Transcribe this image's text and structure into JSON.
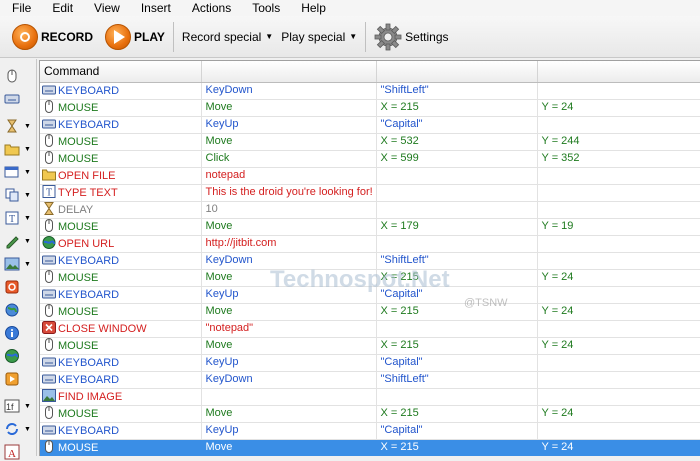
{
  "menu": [
    "File",
    "Edit",
    "View",
    "Insert",
    "Actions",
    "Tools",
    "Help"
  ],
  "toolbar": {
    "record_label": "RECORD",
    "play_label": "PLAY",
    "record_special_label": "Record special",
    "play_special_label": "Play special",
    "settings_label": "Settings"
  },
  "grid": {
    "header": "Command",
    "rows": [
      {
        "command": "KEYBOARD",
        "c2": "KeyDown",
        "c3": "\"ShiftLeft\"",
        "c4": "",
        "kind": "blue",
        "icon": "keyboard-icon"
      },
      {
        "command": "MOUSE",
        "c2": "Move",
        "c3": "X = 215",
        "c4": "Y = 24",
        "kind": "green",
        "icon": "mouse-icon"
      },
      {
        "command": "KEYBOARD",
        "c2": "KeyUp",
        "c3": "\"Capital\"",
        "c4": "",
        "kind": "blue",
        "icon": "keyboard-icon"
      },
      {
        "command": "MOUSE",
        "c2": "Move",
        "c3": "X = 532",
        "c4": "Y = 244",
        "kind": "green",
        "icon": "mouse-icon"
      },
      {
        "command": "MOUSE",
        "c2": "Click",
        "c3": "X = 599",
        "c4": "Y = 352",
        "kind": "green",
        "icon": "mouse-icon"
      },
      {
        "command": "OPEN FILE",
        "c2": "notepad",
        "c3": "",
        "c4": "",
        "kind": "red",
        "icon": "folder-icon"
      },
      {
        "command": "TYPE TEXT",
        "c2": "This is the droid you're looking for!",
        "c3": "",
        "c4": "",
        "kind": "red",
        "icon": "text-icon"
      },
      {
        "command": "DELAY",
        "c2": "10",
        "c3": "",
        "c4": "",
        "kind": "gray",
        "icon": "hourglass-icon"
      },
      {
        "command": "MOUSE",
        "c2": "Move",
        "c3": "X = 179",
        "c4": "Y = 19",
        "kind": "green",
        "icon": "mouse-icon"
      },
      {
        "command": "OPEN URL",
        "c2": "http://jitbit.com",
        "c3": "",
        "c4": "",
        "kind": "red",
        "icon": "globe-icon"
      },
      {
        "command": "KEYBOARD",
        "c2": "KeyDown",
        "c3": "\"ShiftLeft\"",
        "c4": "",
        "kind": "blue",
        "icon": "keyboard-icon"
      },
      {
        "command": "MOUSE",
        "c2": "Move",
        "c3": "X = 215",
        "c4": "Y = 24",
        "kind": "green",
        "icon": "mouse-icon"
      },
      {
        "command": "KEYBOARD",
        "c2": "KeyUp",
        "c3": "\"Capital\"",
        "c4": "",
        "kind": "blue",
        "icon": "keyboard-icon"
      },
      {
        "command": "MOUSE",
        "c2": "Move",
        "c3": "X = 215",
        "c4": "Y = 24",
        "kind": "green",
        "icon": "mouse-icon"
      },
      {
        "command": "CLOSE WINDOW",
        "c2": "\"notepad\"",
        "c3": "",
        "c4": "",
        "kind": "red",
        "icon": "close-window-icon"
      },
      {
        "command": "MOUSE",
        "c2": "Move",
        "c3": "X = 215",
        "c4": "Y = 24",
        "kind": "green",
        "icon": "mouse-icon"
      },
      {
        "command": "KEYBOARD",
        "c2": "KeyUp",
        "c3": "\"Capital\"",
        "c4": "",
        "kind": "blue",
        "icon": "keyboard-icon"
      },
      {
        "command": "KEYBOARD",
        "c2": "KeyDown",
        "c3": "\"ShiftLeft\"",
        "c4": "",
        "kind": "blue",
        "icon": "keyboard-icon"
      },
      {
        "command": "FIND IMAGE",
        "c2": "",
        "c3": "",
        "c4": "",
        "kind": "red",
        "icon": "image-icon"
      },
      {
        "command": "MOUSE",
        "c2": "Move",
        "c3": "X = 215",
        "c4": "Y = 24",
        "kind": "green",
        "icon": "mouse-icon"
      },
      {
        "command": "KEYBOARD",
        "c2": "KeyUp",
        "c3": "\"Capital\"",
        "c4": "",
        "kind": "blue",
        "icon": "keyboard-icon"
      },
      {
        "command": "MOUSE",
        "c2": "Move",
        "c3": "X = 215",
        "c4": "Y = 24",
        "kind": "sel",
        "icon": "mouse-icon"
      }
    ]
  },
  "watermark": {
    "main": "Technospot.Net",
    "sub": "@TSNW"
  },
  "colors": {
    "keyboard": "#2255cc",
    "mouse": "#1e7a1e",
    "action": "#d42020",
    "delay": "#808080",
    "selection": "#3a8ee6"
  }
}
